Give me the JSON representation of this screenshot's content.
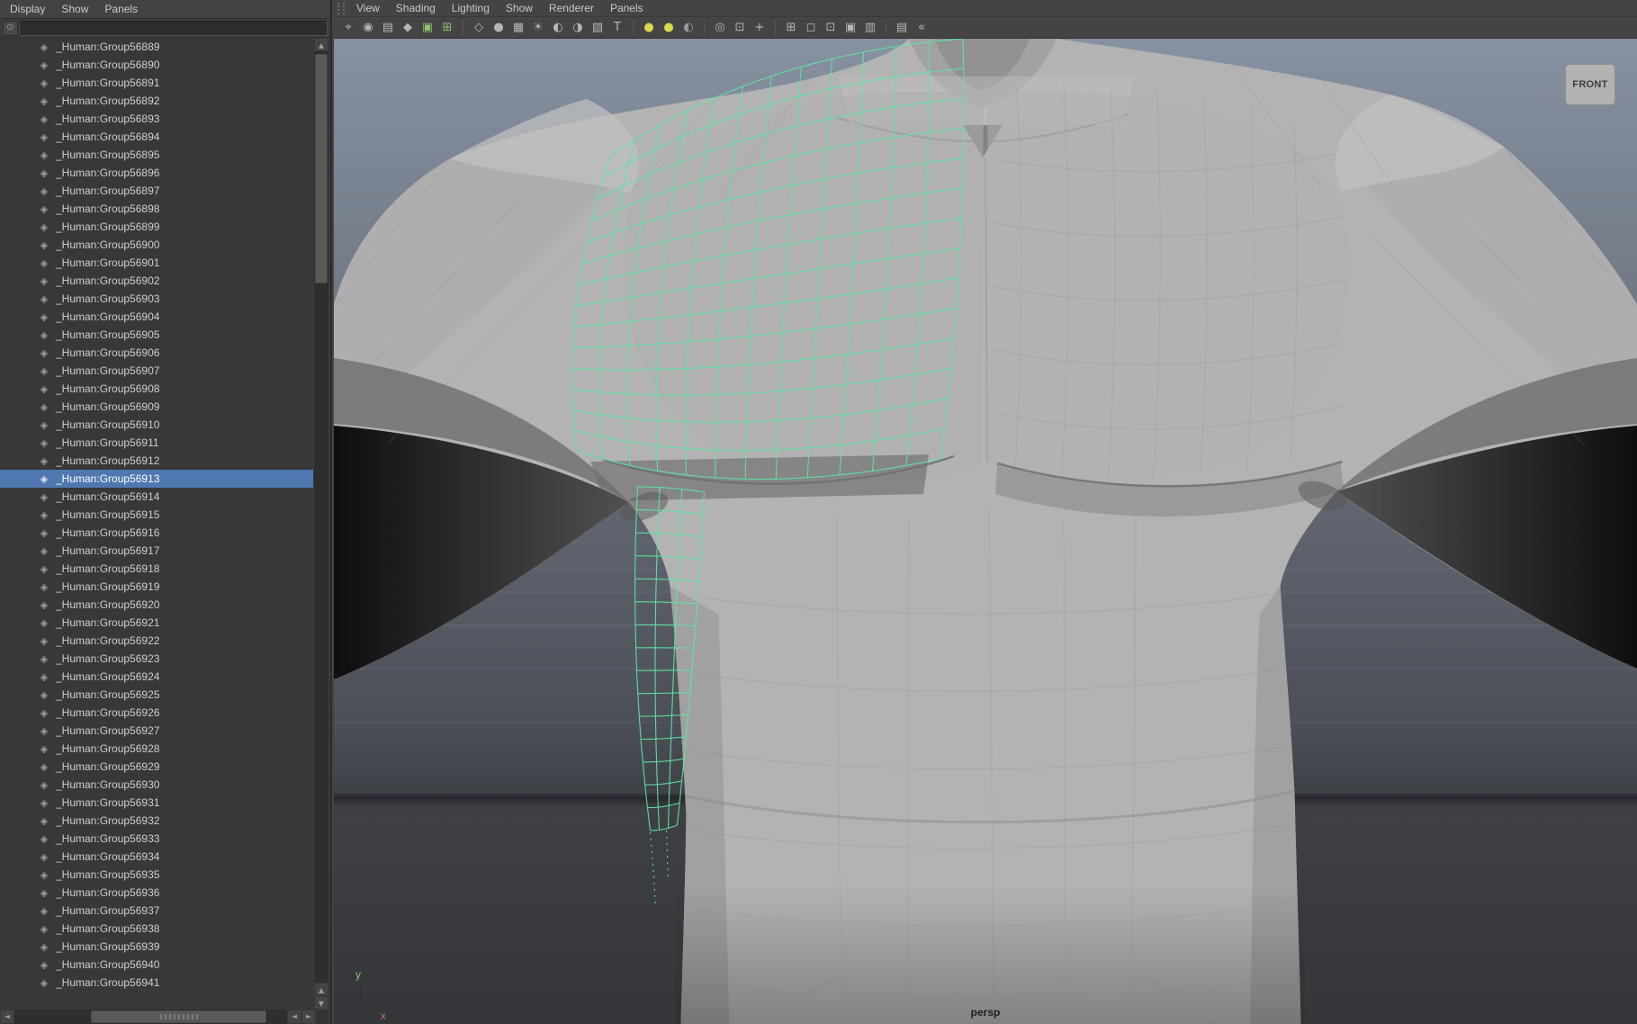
{
  "outliner": {
    "menus": [
      "Display",
      "Show",
      "Panels"
    ],
    "filter": {
      "value": "",
      "placeholder": ""
    },
    "selected_item": "_Human:Group56913",
    "items": [
      "_Human:Group56889",
      "_Human:Group56890",
      "_Human:Group56891",
      "_Human:Group56892",
      "_Human:Group56893",
      "_Human:Group56894",
      "_Human:Group56895",
      "_Human:Group56896",
      "_Human:Group56897",
      "_Human:Group56898",
      "_Human:Group56899",
      "_Human:Group56900",
      "_Human:Group56901",
      "_Human:Group56902",
      "_Human:Group56903",
      "_Human:Group56904",
      "_Human:Group56905",
      "_Human:Group56906",
      "_Human:Group56907",
      "_Human:Group56908",
      "_Human:Group56909",
      "_Human:Group56910",
      "_Human:Group56911",
      "_Human:Group56912",
      "_Human:Group56913",
      "_Human:Group56914",
      "_Human:Group56915",
      "_Human:Group56916",
      "_Human:Group56917",
      "_Human:Group56918",
      "_Human:Group56919",
      "_Human:Group56920",
      "_Human:Group56921",
      "_Human:Group56922",
      "_Human:Group56923",
      "_Human:Group56924",
      "_Human:Group56925",
      "_Human:Group56926",
      "_Human:Group56927",
      "_Human:Group56928",
      "_Human:Group56929",
      "_Human:Group56930",
      "_Human:Group56931",
      "_Human:Group56932",
      "_Human:Group56933",
      "_Human:Group56934",
      "_Human:Group56935",
      "_Human:Group56936",
      "_Human:Group56937",
      "_Human:Group56938",
      "_Human:Group56939",
      "_Human:Group56940",
      "_Human:Group56941"
    ]
  },
  "viewport": {
    "menus": [
      "View",
      "Shading",
      "Lighting",
      "Show",
      "Renderer",
      "Panels"
    ],
    "camera_label": "persp",
    "orientation_badge": "FRONT",
    "axis_labels": {
      "up": "y",
      "right": "x"
    },
    "colors": {
      "selection_wireframe": "#5fe3a1",
      "selection_highlight": "#4f78b0"
    }
  },
  "toolbar": {
    "groups": [
      {
        "icons": [
          {
            "name": "select-camera-icon",
            "glyph": "⌖"
          },
          {
            "name": "lock-camera-icon",
            "glyph": "◉"
          },
          {
            "name": "camera-attributes-icon",
            "glyph": "▤"
          },
          {
            "name": "bookmarks-icon",
            "glyph": "◆"
          },
          {
            "name": "image-plane-icon",
            "glyph": "▣",
            "color": "#8fc46f"
          },
          {
            "name": "pan-zoom-icon",
            "glyph": "⊞",
            "color": "#8fc46f"
          }
        ]
      },
      {
        "icons": [
          {
            "name": "wireframe-icon",
            "glyph": "◇"
          },
          {
            "name": "smooth-shade-icon",
            "glyph": "●"
          },
          {
            "name": "textured-icon",
            "glyph": "▦"
          },
          {
            "name": "use-all-lights-icon",
            "glyph": "☀"
          },
          {
            "name": "shadows-icon",
            "glyph": "◐"
          },
          {
            "name": "occlusion-icon",
            "glyph": "◑"
          },
          {
            "name": "anti-alias-icon",
            "glyph": "▨"
          },
          {
            "name": "textured-channel-icon",
            "glyph": "T"
          }
        ]
      },
      {
        "icons": [
          {
            "name": "exposure-icon",
            "glyph": "●",
            "color": "#d9d94a"
          },
          {
            "name": "gamma-icon",
            "glyph": "●",
            "color": "#d9d94a"
          },
          {
            "name": "background-gradient-icon",
            "glyph": "◐",
            "color": "#9a9a9a"
          }
        ]
      },
      {
        "icons": [
          {
            "name": "isolate-select-icon",
            "glyph": "◎"
          },
          {
            "name": "xray-icon",
            "glyph": "⊡"
          },
          {
            "name": "xray-joints-icon",
            "glyph": "+"
          }
        ]
      },
      {
        "icons": [
          {
            "name": "grid-icon",
            "glyph": "⊞"
          },
          {
            "name": "film-gate-icon",
            "glyph": "◻"
          },
          {
            "name": "resolution-gate-icon",
            "glyph": "⊡"
          },
          {
            "name": "gate-mask-icon",
            "glyph": "▣"
          },
          {
            "name": "field-chart-icon",
            "glyph": "▥"
          }
        ]
      },
      {
        "icons": [
          {
            "name": "hud-icon",
            "glyph": "▤"
          },
          {
            "name": "object-details-icon",
            "glyph": "«"
          }
        ]
      }
    ]
  }
}
